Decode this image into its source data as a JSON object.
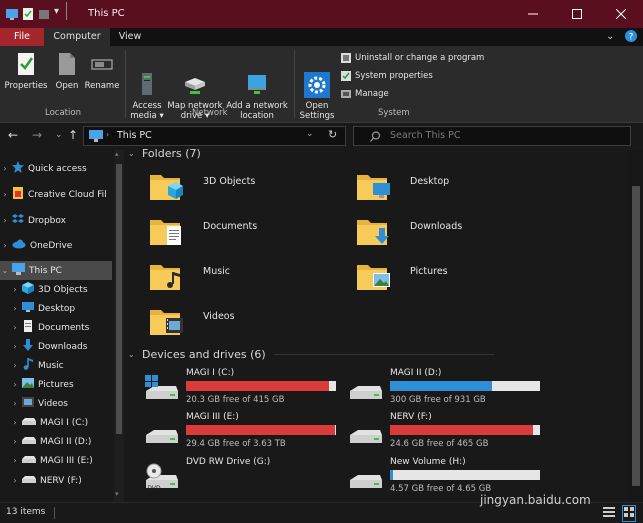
{
  "window": {
    "title": "This PC"
  },
  "ribbon": {
    "tabs": [
      "File",
      "Computer",
      "View"
    ],
    "location": {
      "label": "Location",
      "properties": "Properties",
      "open": "Open",
      "rename": "Rename"
    },
    "network": {
      "label": "Network",
      "access_media": "Access\nmedia ▾",
      "map_drive": "Map network\ndrive ▾",
      "add_location": "Add a network\nlocation"
    },
    "system": {
      "label": "System",
      "open_settings": "Open\nSettings",
      "uninstall": "Uninstall or change a program",
      "properties": "System properties",
      "manage": "Manage"
    }
  },
  "address": {
    "path": "This PC",
    "search_placeholder": "Search This PC"
  },
  "nav": {
    "items": [
      {
        "label": "Quick access",
        "icon": "star-icon"
      },
      {
        "label": "Creative Cloud Fil",
        "icon": "creative-cloud-icon"
      },
      {
        "label": "Dropbox",
        "icon": "dropbox-icon"
      },
      {
        "label": "OneDrive",
        "icon": "cloud-icon"
      },
      {
        "label": "This PC",
        "icon": "monitor-icon"
      },
      {
        "label": "3D Objects",
        "icon": "cube-icon"
      },
      {
        "label": "Desktop",
        "icon": "desktop-icon"
      },
      {
        "label": "Documents",
        "icon": "document-icon"
      },
      {
        "label": "Downloads",
        "icon": "download-icon"
      },
      {
        "label": "Music",
        "icon": "music-icon"
      },
      {
        "label": "Pictures",
        "icon": "picture-icon"
      },
      {
        "label": "Videos",
        "icon": "video-icon"
      },
      {
        "label": "MAGI I (C:)",
        "icon": "drive-icon"
      },
      {
        "label": "MAGI II (D:)",
        "icon": "drive-icon"
      },
      {
        "label": "MAGI III (E:)",
        "icon": "drive-icon"
      },
      {
        "label": "NERV (F:)",
        "icon": "drive-icon"
      }
    ]
  },
  "folders": {
    "header": "Folders (7)",
    "items": [
      "3D Objects",
      "Desktop",
      "Documents",
      "Downloads",
      "Music",
      "Pictures",
      "Videos"
    ]
  },
  "drives": {
    "header": "Devices and drives (6)",
    "items": [
      {
        "name": "MAGI I (C:)",
        "free": "20.3 GB free of 415 GB",
        "used": 0.95,
        "color": "#da3b3b"
      },
      {
        "name": "MAGI II (D:)",
        "free": "300 GB free of 931 GB",
        "used": 0.68,
        "color": "#2f8fd6"
      },
      {
        "name": "MAGI III (E:)",
        "free": "29.4 GB free of 3.63 TB",
        "used": 0.99,
        "color": "#da3b3b"
      },
      {
        "name": "NERV (F:)",
        "free": "24.6 GB free of 465 GB",
        "used": 0.95,
        "color": "#da3b3b"
      },
      {
        "name": "DVD RW Drive (G:)",
        "free": "",
        "used": 0,
        "color": "#da3b3b"
      },
      {
        "name": "New Volume (H:)",
        "free": "4.57 GB free of 4.65 GB",
        "used": 0.02,
        "color": "#2f8fd6"
      }
    ]
  },
  "status": {
    "items": "13 items"
  },
  "watermark": {
    "text": "jingyan.baidu.com"
  },
  "colors": {
    "titlebar": "#5a0f1e",
    "file_tab": "#a4262c",
    "accent_blue": "#2f8fd6",
    "warn_red": "#da3b3b"
  }
}
